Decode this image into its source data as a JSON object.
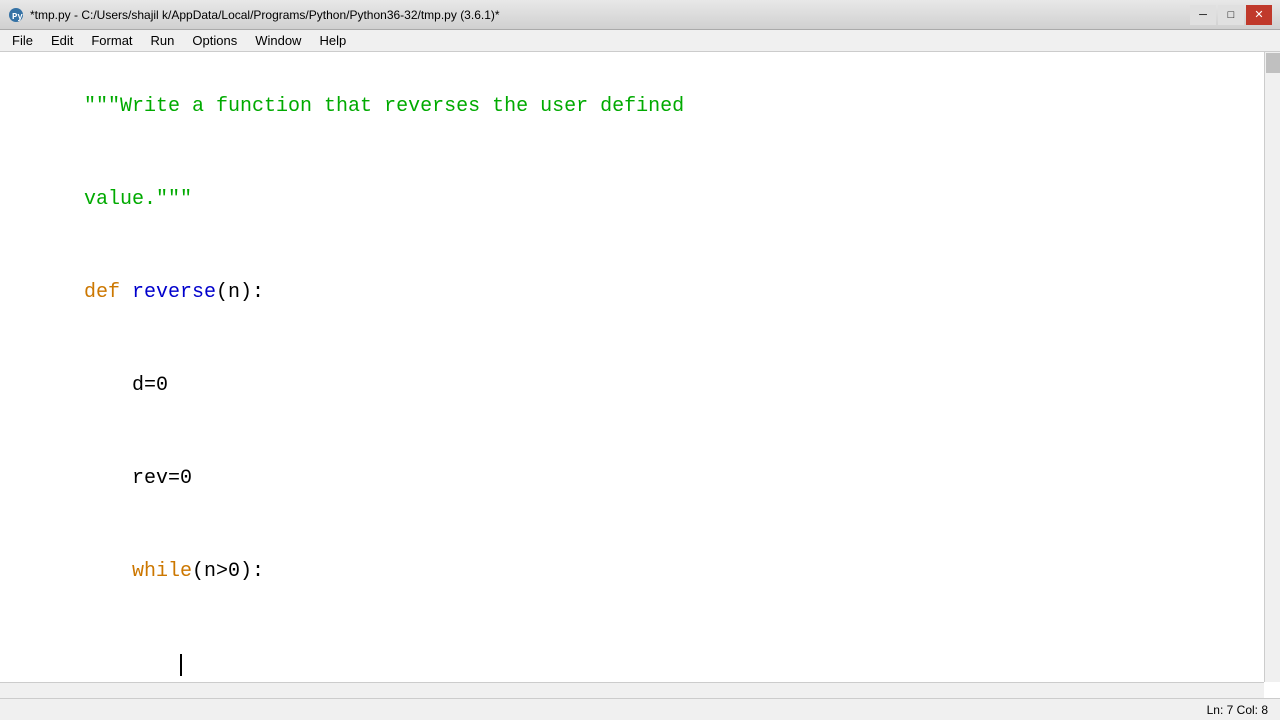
{
  "titlebar": {
    "title": "*tmp.py - C:/Users/shajil k/AppData/Local/Programs/Python/Python36-32/tmp.py (3.6.1)*",
    "icon": "python-icon",
    "minimize": "─",
    "maximize": "□",
    "close": "✕"
  },
  "menubar": {
    "items": [
      "File",
      "Edit",
      "Format",
      "Run",
      "Options",
      "Window",
      "Help"
    ]
  },
  "code": {
    "lines": [
      {
        "type": "docstring",
        "content": "\"\"\"Write a function that reverses the user defined"
      },
      {
        "type": "docstring",
        "content": "value.\"\"\""
      },
      {
        "type": "def",
        "content": "def reverse(n):"
      },
      {
        "type": "body",
        "content": "    d=0"
      },
      {
        "type": "body",
        "content": "    rev=0"
      },
      {
        "type": "while",
        "content": "    while(n>0):"
      },
      {
        "type": "body",
        "content": "        "
      }
    ]
  },
  "statusbar": {
    "position": "Ln: 7   Col: 8"
  }
}
